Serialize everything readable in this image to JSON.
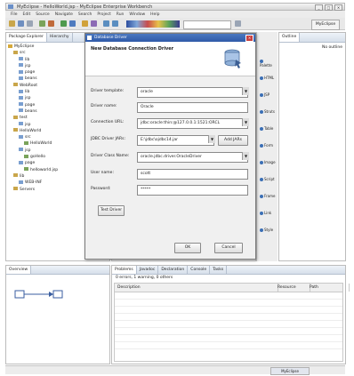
{
  "window": {
    "title": "MyEclipse - HelloWorld.jsp - MyEclipse Enterprise Workbench",
    "buttons": [
      "_",
      "□",
      "×"
    ]
  },
  "menu": [
    "File",
    "Edit",
    "Source",
    "Navigate",
    "Search",
    "Project",
    "Run",
    "Window",
    "Help"
  ],
  "toolbar": {
    "perspective": "MyEclipse"
  },
  "left_pane": {
    "tabs": [
      "Package Explorer",
      "Hierarchy"
    ],
    "tree": [
      {
        "indent": 0,
        "label": "MyEclipse"
      },
      {
        "indent": 1,
        "label": "src"
      },
      {
        "indent": 2,
        "label": "lib"
      },
      {
        "indent": 2,
        "label": "jsp"
      },
      {
        "indent": 2,
        "label": "page"
      },
      {
        "indent": 2,
        "label": "beans"
      },
      {
        "indent": 1,
        "label": "WebRoot"
      },
      {
        "indent": 2,
        "label": "lib"
      },
      {
        "indent": 2,
        "label": "jsp"
      },
      {
        "indent": 2,
        "label": "page"
      },
      {
        "indent": 2,
        "label": "beans"
      },
      {
        "indent": 1,
        "label": "test"
      },
      {
        "indent": 2,
        "label": "jsp"
      },
      {
        "indent": 1,
        "label": "HelloWorld"
      },
      {
        "indent": 2,
        "label": "src"
      },
      {
        "indent": 3,
        "label": "HelloWorld"
      },
      {
        "indent": 2,
        "label": "jsp"
      },
      {
        "indent": 3,
        "label": "goHello"
      },
      {
        "indent": 2,
        "label": "page"
      },
      {
        "indent": 3,
        "label": "helloworld.jsp"
      },
      {
        "indent": 1,
        "label": "lib"
      },
      {
        "indent": 2,
        "label": "WEB-INF"
      },
      {
        "indent": 1,
        "label": "Servers"
      }
    ]
  },
  "dialog": {
    "title": "Database Driver",
    "header": "New Database Connection Driver",
    "fields": [
      {
        "label": "Driver template:",
        "value": "oracle",
        "dropdown": true
      },
      {
        "label": "Driver name:",
        "value": "Oracle",
        "dropdown": false
      },
      {
        "label": "Connection URL:",
        "value": "jdbc:oracle:thin:@127.0.0.1:1521:ORCL",
        "dropdown": true
      },
      {
        "label": "JDBC Driver JARs:",
        "value": "E:\\jdbc\\ojdbc14.jar",
        "dropdown": true
      },
      {
        "label": "Driver Class Name:",
        "value": "oracle.jdbc.driver.OracleDriver",
        "dropdown": true
      },
      {
        "label": "User name:",
        "value": "scott",
        "dropdown": false
      },
      {
        "label": "Password:",
        "value": "*****",
        "dropdown": false
      }
    ],
    "add_jars_label": "Add JARs",
    "test_button": "Test Driver",
    "ok_button": "OK",
    "cancel_button": "Cancel"
  },
  "side_strip": [
    "Palette",
    "HTML",
    "JSP",
    "Struts",
    "Table",
    "Form",
    "Image",
    "Script",
    "Frame",
    "Link",
    "Style"
  ],
  "right_pane": {
    "tab": "Outline",
    "empty_label": "No outline"
  },
  "bottom_left": {
    "tab": "Overview"
  },
  "bottom_right": {
    "tabs": [
      "Problems",
      "Javadoc",
      "Declaration",
      "Console",
      "Tasks"
    ],
    "summary": "0 errors, 1 warning, 0 others",
    "columns": [
      "Description",
      "Resource",
      "Path"
    ]
  },
  "status": {
    "text": "MyEclipse"
  }
}
